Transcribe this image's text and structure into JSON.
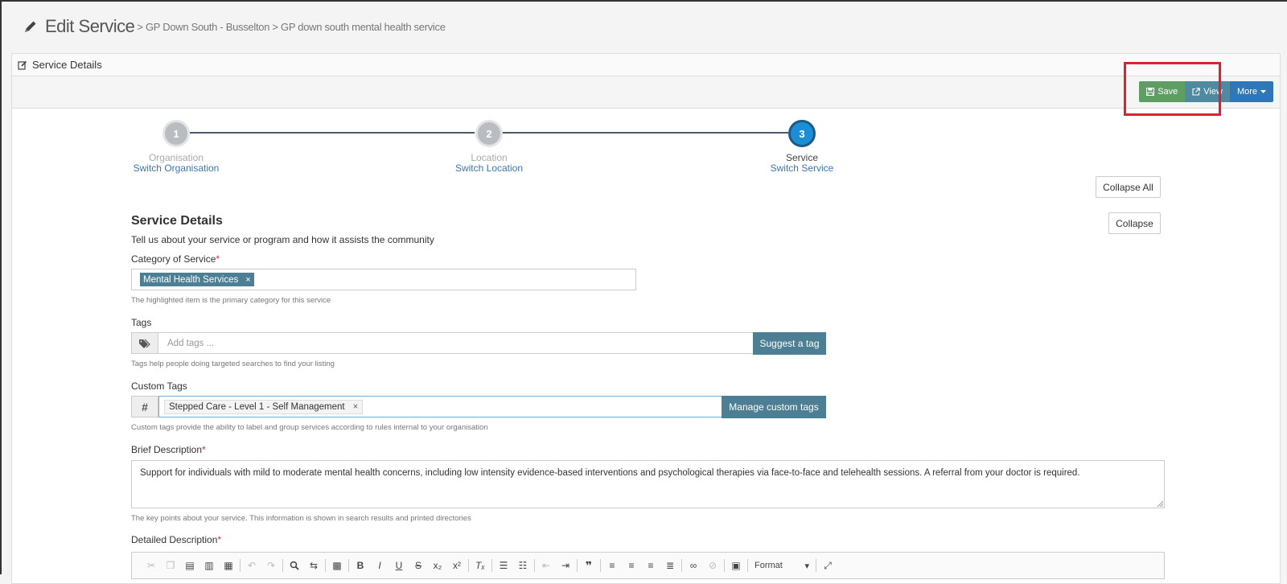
{
  "header": {
    "title": "Edit Service",
    "breadcrumb": "> GP Down South - Busselton > GP down south mental health service"
  },
  "panel": {
    "heading": "Service Details",
    "buttons": {
      "save": "Save",
      "view": "View",
      "more": "More"
    }
  },
  "wizard": {
    "steps": [
      {
        "number": "1",
        "label": "Organisation",
        "link": "Switch Organisation"
      },
      {
        "number": "2",
        "label": "Location",
        "link": "Switch Location"
      },
      {
        "number": "3",
        "label": "Service",
        "link": "Switch Service"
      }
    ]
  },
  "actions": {
    "collapse_all": "Collapse All",
    "collapse": "Collapse"
  },
  "form": {
    "section_title": "Service Details",
    "section_desc": "Tell us about your service or program and how it assists the community",
    "category": {
      "label": "Category of Service",
      "required": "*",
      "value": "Mental Health Services",
      "help": "The highlighted item is the primary category for this service"
    },
    "tags": {
      "label": "Tags",
      "placeholder": "Add tags ...",
      "button": "Suggest a tag",
      "help": "Tags help people doing targeted searches to find your listing"
    },
    "custom_tags": {
      "label": "Custom Tags",
      "addon": "#",
      "value": "Stepped Care - Level 1 - Self Management",
      "button": "Manage custom tags",
      "help": "Custom tags provide the ability to label and group services according to rules internal to your organisation"
    },
    "brief_description": {
      "label": "Brief Description",
      "required": "*",
      "value": "Support for individuals with mild to moderate mental health concerns, including low intensity evidence-based interventions and psychological therapies via face-to-face and telehealth sessions. A referral from your doctor is required.",
      "help": "The key points about your service. This information is shown in search results and printed directories"
    },
    "detailed_description": {
      "label": "Detailed Description",
      "required": "*",
      "format_label": "Format"
    }
  },
  "colors": {
    "save": "#5f9e63",
    "view": "#4f8aa0",
    "more": "#2f77b8",
    "active_step": "#1a8fd6",
    "highlight_box": "#e0202c"
  }
}
